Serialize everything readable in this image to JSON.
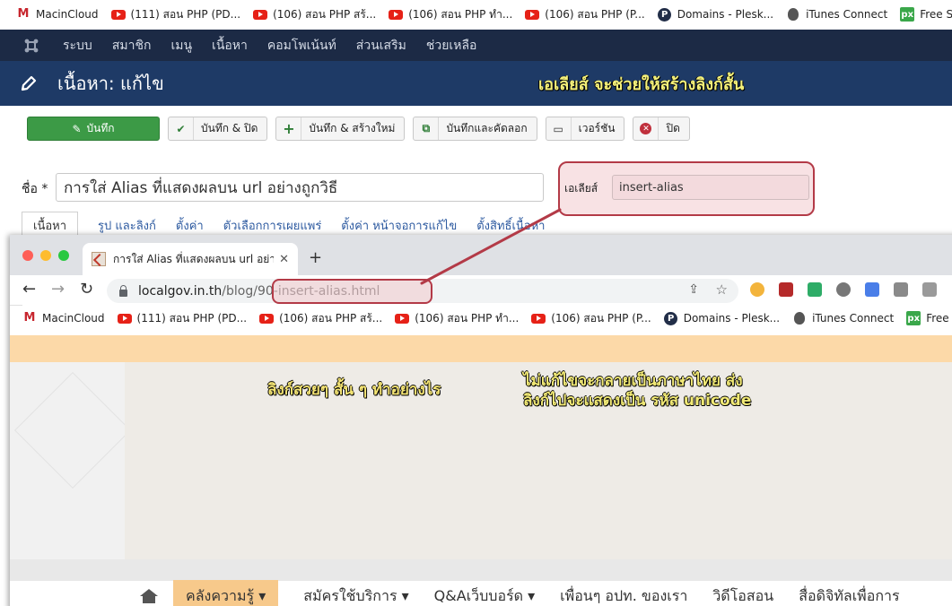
{
  "top_bookmarks": [
    {
      "icon": "macincloud-icon",
      "label": "MacinCloud"
    },
    {
      "icon": "youtube-icon",
      "label": "(111) สอน PHP (PD..."
    },
    {
      "icon": "youtube-icon",
      "label": "(106) สอน PHP สร้..."
    },
    {
      "icon": "youtube-icon",
      "label": "(106) สอน PHP ทำ..."
    },
    {
      "icon": "youtube-icon",
      "label": "(106) สอน PHP (P..."
    },
    {
      "icon": "plesk-icon",
      "label": "Domains - Plesk..."
    },
    {
      "icon": "apple-icon",
      "label": "iTunes Connect"
    },
    {
      "icon": "pixabay-icon",
      "label": "Free St"
    }
  ],
  "joomla": {
    "nav": [
      "ระบบ",
      "สมาชิก",
      "เมนู",
      "เนื้อหา",
      "คอมโพเน้นท์",
      "ส่วนเสริม",
      "ช่วยเหลือ"
    ],
    "page_title": "เนื้อหา: แก้ไข",
    "annotation_alias": "เอเลียส์ จะช่วยให้สร้างลิงก์สั้น",
    "toolbar": {
      "save": "บันทึก",
      "save_close": "บันทึก & ปิด",
      "save_new": "บันทึก & สร้างใหม่",
      "save_copy": "บันทึกและคัดลอก",
      "versions": "เวอร์ชัน",
      "close": "ปิด"
    },
    "title_label": "ชื่อ *",
    "title_value": "การใส่ Alias ที่แสดงผลบน url อย่างถูกวิธี",
    "alias_label": "เอเลียส์",
    "alias_value": "insert-alias",
    "tabs": [
      "เนื้อหา",
      "รูป และลิงก์",
      "ตั้งค่า",
      "ตัวเลือกการเผยแพร่",
      "ตั้งค่า หน้าจอการแก้ไข",
      "ตั้งสิทธิ์เนื้อหา"
    ]
  },
  "browser": {
    "tab_title": "การใส่ Alias ที่แสดงผลบน url อย่าง",
    "url_host": "localgov.in.th",
    "url_path": "/blog/90-insert-alias.html",
    "bookmarks": [
      {
        "icon": "macincloud-icon",
        "label": "MacinCloud"
      },
      {
        "icon": "youtube-icon",
        "label": "(111) สอน PHP (PD..."
      },
      {
        "icon": "youtube-icon",
        "label": "(106) สอน PHP สร้..."
      },
      {
        "icon": "youtube-icon",
        "label": "(106) สอน PHP ทำ..."
      },
      {
        "icon": "youtube-icon",
        "label": "(106) สอน PHP (P..."
      },
      {
        "icon": "plesk-icon",
        "label": "Domains - Plesk..."
      },
      {
        "icon": "apple-icon",
        "label": "iTunes Connect"
      },
      {
        "icon": "pixabay-icon",
        "label": "Free St"
      }
    ]
  },
  "site": {
    "note_link": "ลิงก์สวยๆ สั้น ๆ ทำอย่างไร",
    "note_unicode_line1": "ไม่แก้ไขจะกลายเป็นภาษาไทย ส่ง",
    "note_unicode_line2": "ลิงก์ไปจะแสดงเป็น รหัส unicode",
    "menu": [
      "คลังความรู้ ▾",
      "สมัครใช้บริการ ▾",
      "Q&Aเว็บบอร์ด ▾",
      "เพื่อนๆ อปท. ของเรา",
      "วิดีโอสอน",
      "สื่อดิจิทัลเพื่อการ"
    ]
  },
  "colors": {
    "joomla_nav": "#1c2a45",
    "joomla_header": "#1e3a66",
    "save_green": "#3c9a46",
    "highlight_red": "#b33a47",
    "site_orange": "#fcd9a8"
  }
}
